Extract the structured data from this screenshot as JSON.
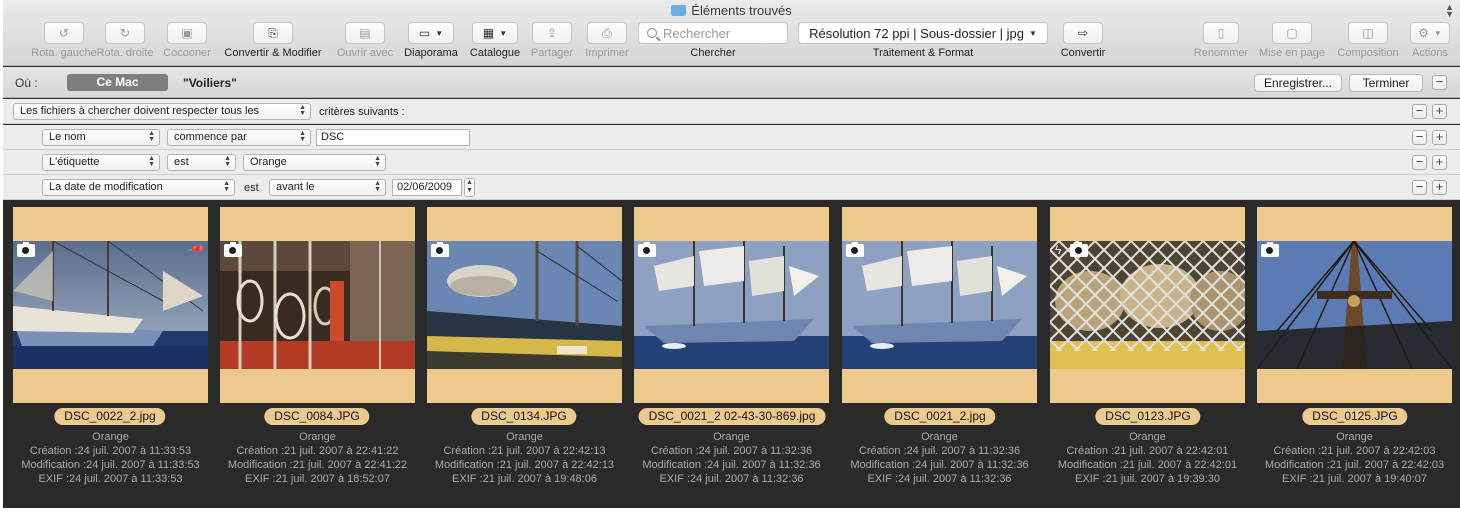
{
  "window": {
    "title": "Éléments trouvés"
  },
  "toolbar": {
    "rotate_left": "Rota. gauche",
    "rotate_right": "Rota. droite",
    "cocoon": "Cocooner",
    "convert_modify": "Convertir & Modifier",
    "open_with": "Ouvrir avec",
    "slideshow": "Diaporama",
    "catalog": "Catalogue",
    "share": "Partager",
    "print": "Imprimer",
    "search_placeholder": "Rechercher",
    "search_label": "Chercher",
    "format_value": "Résolution 72 ppi | Sous-dossier | jpg",
    "format_label": "Traitement & Format",
    "convert": "Convertir",
    "rename": "Renommer",
    "layout": "Mise en page",
    "composition": "Composition",
    "actions": "Actions"
  },
  "scope": {
    "label": "Où :",
    "this_mac": "Ce Mac",
    "folder": "\"Voiliers\"",
    "save": "Enregistrer...",
    "done": "Terminer"
  },
  "criteria": {
    "match_popup": "Les fichiers à chercher doivent respecter tous les",
    "match_suffix": "critères suivants :",
    "rows": [
      {
        "attribute": "Le nom",
        "operator": "commence par",
        "value": "DSC"
      },
      {
        "attribute": "L'étiquette",
        "operator_text": "est",
        "operator": "",
        "value": "Orange"
      },
      {
        "attribute": "La date de modification",
        "operator_text": "est",
        "operator": "avant le",
        "value": "02/06/2009"
      }
    ]
  },
  "photos": [
    {
      "name": "DSC_0022_2.jpg",
      "label": "Orange",
      "creation": "Création :24 juil. 2007 à 11:33:53",
      "modification": "Modification :24 juil. 2007 à 11:33:53",
      "exif": "EXIF :24 juil. 2007 à 11:33:53"
    },
    {
      "name": "DSC_0084.JPG",
      "label": "Orange",
      "creation": "Création :21 juil. 2007 à 22:41:22",
      "modification": "Modification :21 juil. 2007 à 22:41:22",
      "exif": "EXIF :21 juil. 2007 à 18:52:07"
    },
    {
      "name": "DSC_0134.JPG",
      "label": "Orange",
      "creation": "Création :21 juil. 2007 à 22:42:13",
      "modification": "Modification :21 juil. 2007 à 22:42:13",
      "exif": "EXIF :21 juil. 2007 à 19:48:06"
    },
    {
      "name": "DSC_0021_2 02-43-30-869.jpg",
      "label": "Orange",
      "creation": "Création :24 juil. 2007 à 11:32:36",
      "modification": "Modification :24 juil. 2007 à 11:32:36",
      "exif": "EXIF :24 juil. 2007 à 11:32:36"
    },
    {
      "name": "DSC_0021_2.jpg",
      "label": "Orange",
      "creation": "Création :24 juil. 2007 à 11:32:36",
      "modification": "Modification :24 juil. 2007 à 11:32:36",
      "exif": "EXIF :24 juil. 2007 à 11:32:36"
    },
    {
      "name": "DSC_0123.JPG",
      "label": "Orange",
      "creation": "Création :21 juil. 2007 à 22:42:01",
      "modification": "Modification :21 juil. 2007 à 22:42:01",
      "exif": "EXIF :21 juil. 2007 à 19:39:30"
    },
    {
      "name": "DSC_0125.JPG",
      "label": "Orange",
      "creation": "Création :21 juil. 2007 à 22:42:03",
      "modification": "Modification :21 juil. 2007 à 22:42:03",
      "exif": "EXIF :21 juil. 2007 à 19:40:07"
    }
  ],
  "colors": {
    "label_orange": "#eec98d",
    "browser_bg": "#2a2a2a"
  }
}
